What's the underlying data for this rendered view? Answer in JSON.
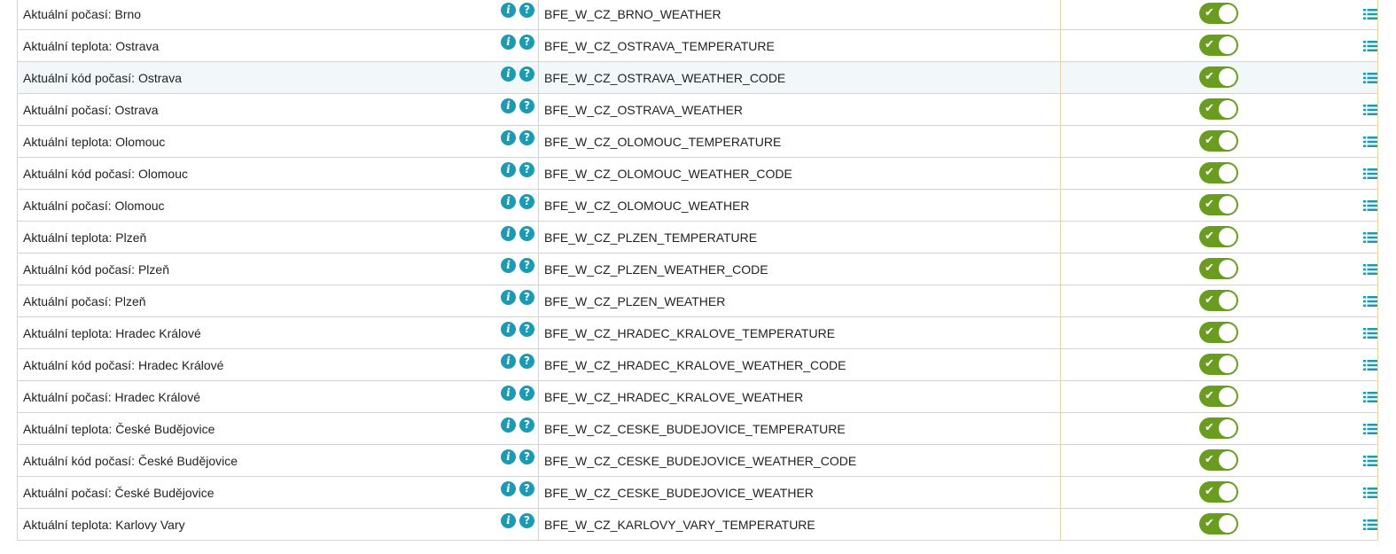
{
  "colors": {
    "border": "#e6d3a6",
    "toggle_on": "#6a9d1f",
    "icon_accent": "#1a9bb4",
    "row_highlight": "#f2f8fa"
  },
  "icons": {
    "info": "i",
    "help": "?",
    "toggle_check": "✔"
  },
  "rows": [
    {
      "name": "Aktuální počasí: Brno",
      "code": "BFE_W_CZ_BRNO_WEATHER",
      "enabled": true
    },
    {
      "name": "Aktuální teplota: Ostrava",
      "code": "BFE_W_CZ_OSTRAVA_TEMPERATURE",
      "enabled": true
    },
    {
      "name": "Aktuální kód počasí: Ostrava",
      "code": "BFE_W_CZ_OSTRAVA_WEATHER_CODE",
      "enabled": true,
      "highlight": true
    },
    {
      "name": "Aktuální počasí: Ostrava",
      "code": "BFE_W_CZ_OSTRAVA_WEATHER",
      "enabled": true
    },
    {
      "name": "Aktuální teplota: Olomouc",
      "code": "BFE_W_CZ_OLOMOUC_TEMPERATURE",
      "enabled": true
    },
    {
      "name": "Aktuální kód počasí: Olomouc",
      "code": "BFE_W_CZ_OLOMOUC_WEATHER_CODE",
      "enabled": true
    },
    {
      "name": "Aktuální počasí: Olomouc",
      "code": "BFE_W_CZ_OLOMOUC_WEATHER",
      "enabled": true
    },
    {
      "name": "Aktuální teplota: Plzeň",
      "code": "BFE_W_CZ_PLZEN_TEMPERATURE",
      "enabled": true
    },
    {
      "name": "Aktuální kód počasí: Plzeň",
      "code": "BFE_W_CZ_PLZEN_WEATHER_CODE",
      "enabled": true
    },
    {
      "name": "Aktuální počasí: Plzeň",
      "code": "BFE_W_CZ_PLZEN_WEATHER",
      "enabled": true
    },
    {
      "name": "Aktuální teplota: Hradec Králové",
      "code": "BFE_W_CZ_HRADEC_KRALOVE_TEMPERATURE",
      "enabled": true
    },
    {
      "name": "Aktuální kód počasí: Hradec Králové",
      "code": "BFE_W_CZ_HRADEC_KRALOVE_WEATHER_CODE",
      "enabled": true
    },
    {
      "name": "Aktuální počasí: Hradec Králové",
      "code": "BFE_W_CZ_HRADEC_KRALOVE_WEATHER",
      "enabled": true
    },
    {
      "name": "Aktuální teplota: České Budějovice",
      "code": "BFE_W_CZ_CESKE_BUDEJOVICE_TEMPERATURE",
      "enabled": true
    },
    {
      "name": "Aktuální kód počasí: České Budějovice",
      "code": "BFE_W_CZ_CESKE_BUDEJOVICE_WEATHER_CODE",
      "enabled": true
    },
    {
      "name": "Aktuální počasí: České Budějovice",
      "code": "BFE_W_CZ_CESKE_BUDEJOVICE_WEATHER",
      "enabled": true
    },
    {
      "name": "Aktuální teplota: Karlovy Vary",
      "code": "BFE_W_CZ_KARLOVY_VARY_TEMPERATURE",
      "enabled": true
    }
  ]
}
